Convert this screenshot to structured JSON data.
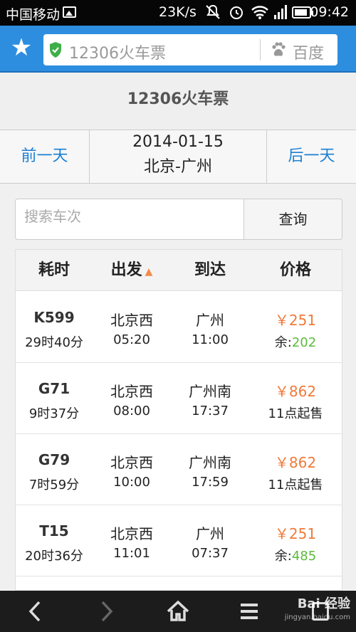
{
  "status_bar": {
    "carrier": "中国移动",
    "speed": "23K/s",
    "time": "09:42"
  },
  "browser": {
    "url_text": "12306火车票",
    "search_engine": "百度"
  },
  "page": {
    "title": "12306火车票"
  },
  "date_nav": {
    "prev_label": "前一天",
    "next_label": "后一天",
    "date": "2014-01-15",
    "route": "北京-广州"
  },
  "search": {
    "placeholder": "搜索车次",
    "button_label": "查询"
  },
  "table": {
    "headers": [
      "耗时",
      "出发",
      "到达",
      "价格"
    ],
    "sort_indicator": "▲",
    "rows": [
      {
        "train": "K599",
        "duration": "29时40分",
        "from": "北京西",
        "depart": "05:20",
        "to": "广州",
        "arrive": "11:00",
        "price": "￥251",
        "avail_label": "余:",
        "avail_value": "202",
        "note": ""
      },
      {
        "train": "G71",
        "duration": "9时37分",
        "from": "北京西",
        "depart": "08:00",
        "to": "广州南",
        "arrive": "17:37",
        "price": "￥862",
        "avail_label": "",
        "avail_value": "",
        "note": "11点起售"
      },
      {
        "train": "G79",
        "duration": "7时59分",
        "from": "北京西",
        "depart": "10:00",
        "to": "广州南",
        "arrive": "17:59",
        "price": "￥862",
        "avail_label": "",
        "avail_value": "",
        "note": "11点起售"
      },
      {
        "train": "T15",
        "duration": "20时36分",
        "from": "北京西",
        "depart": "11:01",
        "to": "广州",
        "arrive": "07:37",
        "price": "￥251",
        "avail_label": "余:",
        "avail_value": "485",
        "note": ""
      }
    ]
  },
  "watermark": {
    "main": "Bai 经验",
    "sub": "jingyan.baidu.com"
  },
  "colors": {
    "accent": "#2d8ee0",
    "link": "#1a7fd4",
    "price": "#f07a3a",
    "available": "#5bbb3b"
  }
}
